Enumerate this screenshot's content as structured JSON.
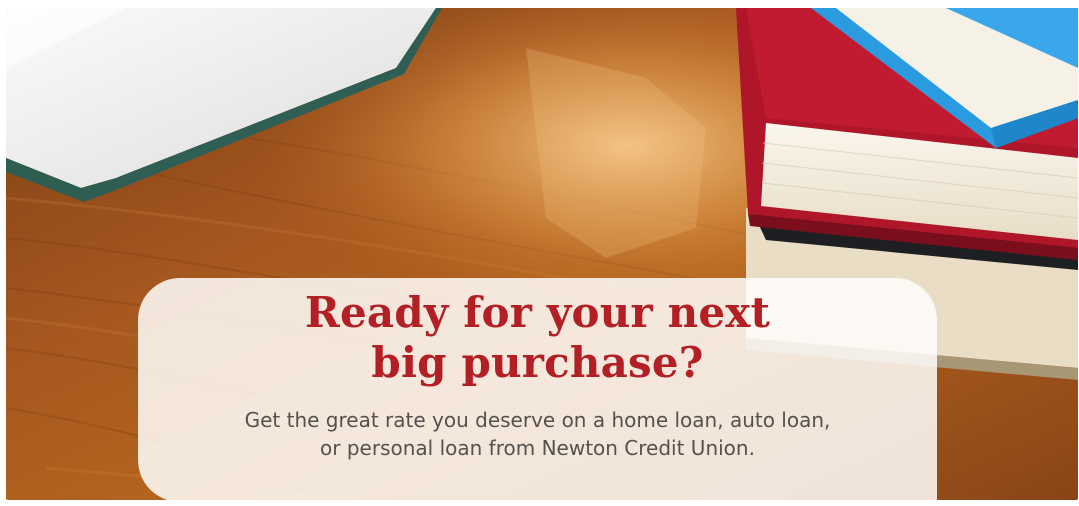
{
  "banner": {
    "headline_line1": "Ready for your next",
    "headline_line2": "big purchase?",
    "subtext_line1": "Get the great rate you deserve on a home loan, auto loan,",
    "subtext_line2": "or personal loan from Newton Credit Union."
  },
  "colors": {
    "headline": "#b22025",
    "subtext": "#55514d",
    "wood": "#a0561e",
    "callout_bg": "#fffdfa"
  }
}
